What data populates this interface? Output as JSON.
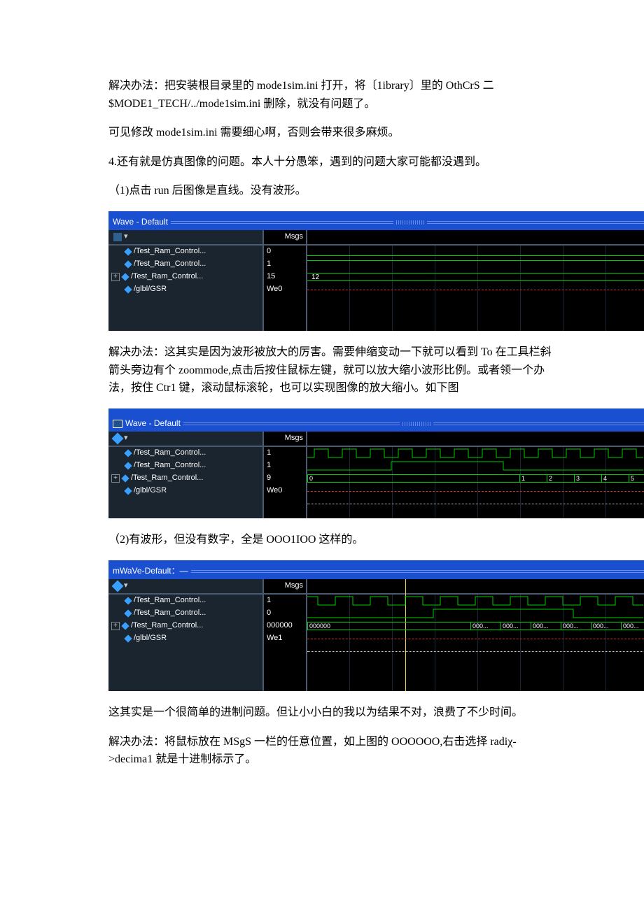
{
  "body": {
    "p1": "解决办法：把安装根目录里的 mode1sim.ini 打开，将〔1ibrary〕里的 OthCrS 二$MODE1_TECH/../mode1sim.ini 删除，就没有问题了。",
    "p2": "可见修改 mode1sim.ini 需要细心啊，否则会带来很多麻烦。",
    "p3": "4.还有就是仿真图像的问题。本人十分愚笨，遇到的问题大家可能都没遇到。",
    "p4": "（1)点击 run 后图像是直线。没有波形。",
    "p5": "解决办法：这其实是因为波形被放大的厉害。需要伸缩变动一下就可以看到 To 在工具栏斜箭头旁边有个 zoommode,点击后按住鼠标左键，就可以放大缩小波形比例。或者领一个办法，按住 Ctr1 键，滚动鼠标滚轮，也可以实现图像的放大缩小。如下图",
    "p6": "（2)有波形，但没有数字，全是 OOO1IOO 这样的。",
    "p7": "这其实是一个很简单的进制问题。但让小小白的我以为结果不对，浪费了不少时间。",
    "p8": "解决办法：将鼠标放在 MSgS 一栏的任意位置，如上图的 OOOOOO,右击选择 radiχ->decima1 就是十进制标示了。"
  },
  "wave1": {
    "title": "Wave - Default",
    "msgs_header": "Msgs",
    "signals": [
      {
        "name": "/Test_Ram_Control...",
        "val": "0",
        "expand": false
      },
      {
        "name": "/Test_Ram_Control...",
        "val": "1",
        "expand": false
      },
      {
        "name": "/Test_Ram_Control...",
        "val": "15",
        "expand": true
      },
      {
        "name": "/glbl/GSR",
        "val": "We0",
        "expand": false
      }
    ],
    "bus_label": "12"
  },
  "wave2": {
    "title": "Wave - Default",
    "msgs_header": "Msgs",
    "signals": [
      {
        "name": "/Test_Ram_Control...",
        "val": "1",
        "expand": false
      },
      {
        "name": "/Test_Ram_Control...",
        "val": "1",
        "expand": false
      },
      {
        "name": "/Test_Ram_Control...",
        "val": "9",
        "expand": true
      },
      {
        "name": "/glbl/GSR",
        "val": "We0",
        "expand": false
      }
    ],
    "bus_first": "0",
    "bus_ticks": [
      "1",
      "2",
      "3",
      "4",
      "5"
    ]
  },
  "wave3": {
    "title": "mWaVe-Default：—",
    "msgs_header": "Msgs",
    "signals": [
      {
        "name": "/Test_Ram_Control...",
        "val": "1",
        "expand": false
      },
      {
        "name": "/Test_Ram_Control...",
        "val": "0",
        "expand": false
      },
      {
        "name": "/Test_Ram_Control...",
        "val": "000000",
        "expand": true
      },
      {
        "name": "/glbl/GSR",
        "val": "We1",
        "expand": false
      }
    ],
    "bus_first": "000000",
    "bus_ticks": [
      "000...",
      "000...",
      "000...",
      "000...",
      "000...",
      "000..."
    ]
  }
}
